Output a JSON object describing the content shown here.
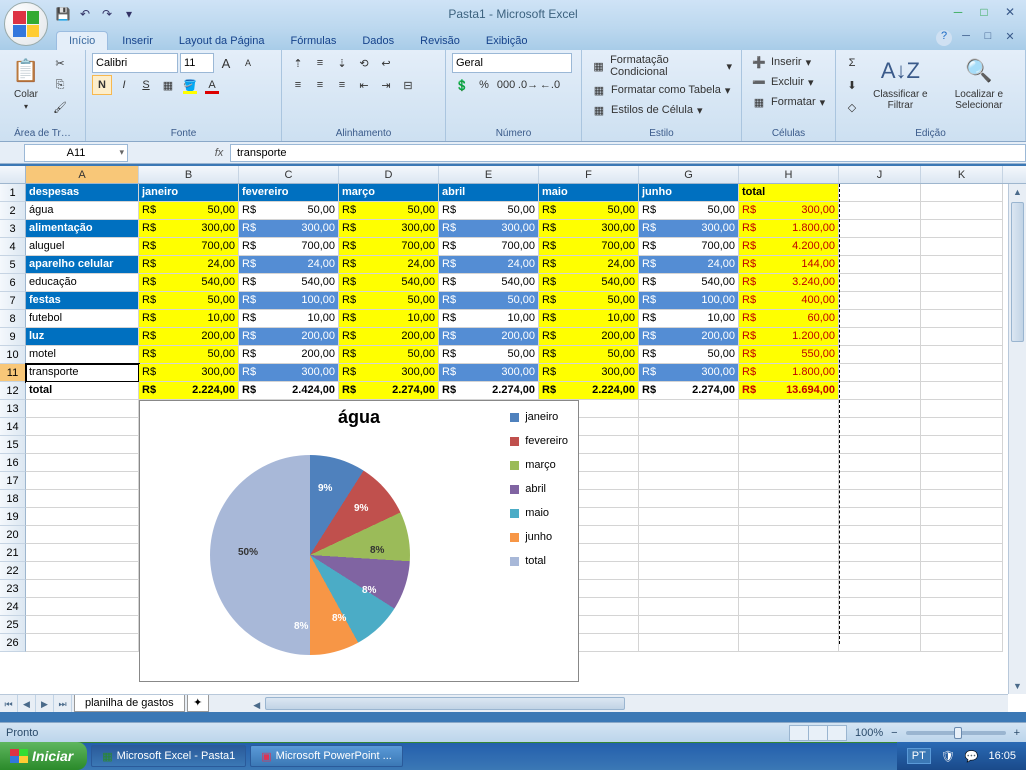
{
  "app": {
    "title": "Pasta1 - Microsoft Excel"
  },
  "tabs": {
    "inicio": "Início",
    "inserir": "Inserir",
    "layout": "Layout da Página",
    "formulas": "Fórmulas",
    "dados": "Dados",
    "revisao": "Revisão",
    "exibicao": "Exibição"
  },
  "ribbon": {
    "transferencia": {
      "label": "Área de Tr…",
      "colar": "Colar"
    },
    "fonte": {
      "label": "Fonte",
      "name": "Calibri",
      "size": "11"
    },
    "alinhamento": {
      "label": "Alinhamento"
    },
    "numero": {
      "label": "Número",
      "format": "Geral"
    },
    "estilo": {
      "label": "Estilo",
      "cond": "Formatação Condicional",
      "tabela": "Formatar como Tabela",
      "celula": "Estilos de Célula"
    },
    "celulas": {
      "label": "Células",
      "inserir": "Inserir",
      "excluir": "Excluir",
      "formatar": "Formatar"
    },
    "edicao": {
      "label": "Edição",
      "classificar": "Classificar e Filtrar",
      "localizar": "Localizar e Selecionar"
    }
  },
  "formula_bar": {
    "namebox": "A11",
    "fx": "fx",
    "value": "transporte"
  },
  "columns": [
    "A",
    "B",
    "C",
    "D",
    "E",
    "F",
    "G",
    "H",
    "J",
    "K"
  ],
  "headers": {
    "A": "despesas",
    "B": "janeiro",
    "C": "fevereiro",
    "D": "março",
    "E": "abril",
    "F": "maio",
    "G": "junho",
    "H": "total"
  },
  "rows": [
    {
      "label": "água",
      "vals": [
        "50,00",
        "50,00",
        "50,00",
        "50,00",
        "50,00",
        "50,00"
      ],
      "total": "300,00"
    },
    {
      "label": "alimentação",
      "vals": [
        "300,00",
        "300,00",
        "300,00",
        "300,00",
        "300,00",
        "300,00"
      ],
      "total": "1.800,00"
    },
    {
      "label": "aluguel",
      "vals": [
        "700,00",
        "700,00",
        "700,00",
        "700,00",
        "700,00",
        "700,00"
      ],
      "total": "4.200,00"
    },
    {
      "label": "aparelho celular",
      "vals": [
        "24,00",
        "24,00",
        "24,00",
        "24,00",
        "24,00",
        "24,00"
      ],
      "total": "144,00"
    },
    {
      "label": "educação",
      "vals": [
        "540,00",
        "540,00",
        "540,00",
        "540,00",
        "540,00",
        "540,00"
      ],
      "total": "3.240,00"
    },
    {
      "label": "festas",
      "vals": [
        "50,00",
        "100,00",
        "50,00",
        "50,00",
        "50,00",
        "100,00"
      ],
      "total": "400,00"
    },
    {
      "label": "futebol",
      "vals": [
        "10,00",
        "10,00",
        "10,00",
        "10,00",
        "10,00",
        "10,00"
      ],
      "total": "60,00"
    },
    {
      "label": "luz",
      "vals": [
        "200,00",
        "200,00",
        "200,00",
        "200,00",
        "200,00",
        "200,00"
      ],
      "total": "1.200,00"
    },
    {
      "label": "motel",
      "vals": [
        "50,00",
        "200,00",
        "50,00",
        "50,00",
        "50,00",
        "50,00"
      ],
      "total": "550,00"
    },
    {
      "label": "transporte",
      "vals": [
        "300,00",
        "300,00",
        "300,00",
        "300,00",
        "300,00",
        "300,00"
      ],
      "total": "1.800,00"
    },
    {
      "label": "total",
      "vals": [
        "2.224,00",
        "2.424,00",
        "2.274,00",
        "2.274,00",
        "2.224,00",
        "2.274,00"
      ],
      "total": "13.694,00"
    }
  ],
  "currency": "R$",
  "chart_data": {
    "type": "pie",
    "title": "água",
    "series": [
      {
        "name": "água",
        "values": [
          50,
          50,
          50,
          50,
          50,
          50,
          300
        ]
      }
    ],
    "categories": [
      "janeiro",
      "fevereiro",
      "março",
      "abril",
      "maio",
      "junho",
      "total"
    ],
    "labels": [
      "9%",
      "9%",
      "8%",
      "8%",
      "8%",
      "8%",
      "50%"
    ],
    "colors": [
      "#4f81bd",
      "#c0504d",
      "#9bbb59",
      "#8064a2",
      "#4bacc6",
      "#f79646",
      "#a8b8d8"
    ]
  },
  "sheet": {
    "name": "planilha de gastos"
  },
  "status": {
    "ready": "Pronto",
    "zoom": "100%"
  },
  "taskbar": {
    "start": "Iniciar",
    "excel": "Microsoft Excel - Pasta1",
    "ppt": "Microsoft PowerPoint ...",
    "lang": "PT",
    "clock": "16:05"
  }
}
